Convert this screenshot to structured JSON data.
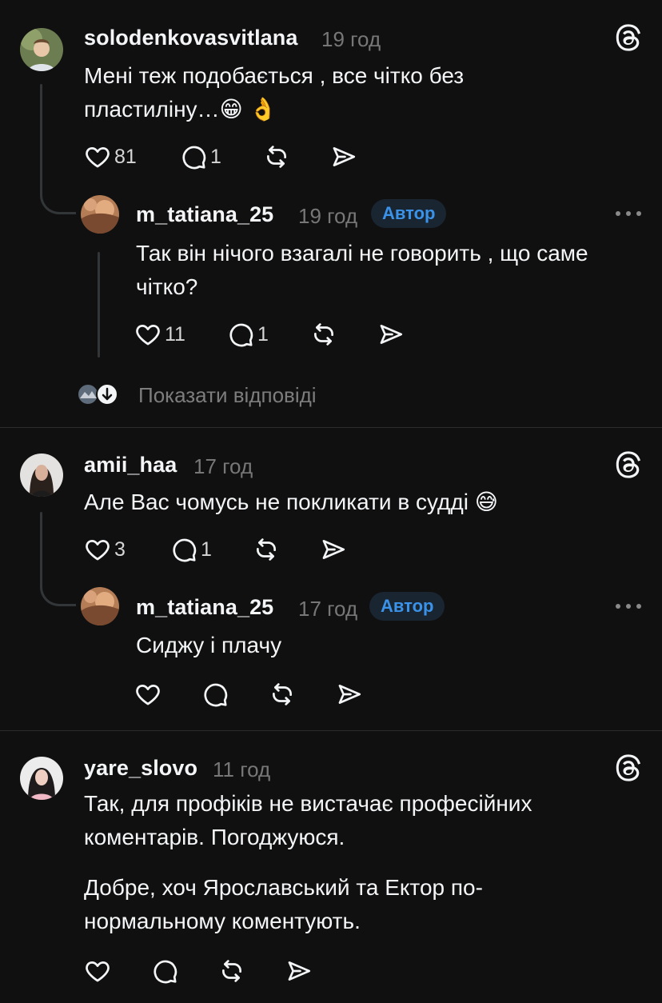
{
  "comments": [
    {
      "username": "solodenkovasvitlana",
      "time": "19 год",
      "text": "Мені теж подобається , все чітко без пластиліну…😁 👌",
      "likes": "81",
      "replies": "1",
      "reply": {
        "username": "m_tatiana_25",
        "time": "19 год",
        "badge": "Автор",
        "text": "Так він нічого взагалі не говорить , що саме чітко?",
        "likes": "11",
        "replies": "1"
      },
      "show_replies": "Показати відповіді"
    },
    {
      "username": "amii_haa",
      "time": "17 год",
      "text": "Але Вас чомусь не покликати в судді 😅",
      "likes": "3",
      "replies": "1",
      "reply": {
        "username": "m_tatiana_25",
        "time": "17 год",
        "badge": "Автор",
        "text": "Сиджу і плачу"
      }
    },
    {
      "username": "yare_slovo",
      "time": "11 год",
      "text1": "Так, для профіків не вистачає професійних коментарів. Погоджуюся.",
      "text2": "Добре, хоч Ярославський та Ектор по-нормальному коментують."
    }
  ],
  "colors": {
    "background": "#101010",
    "text": "#f3f5f7",
    "muted": "#777777",
    "badge_text": "#3a93e8",
    "badge_bg": "#1a2532"
  }
}
